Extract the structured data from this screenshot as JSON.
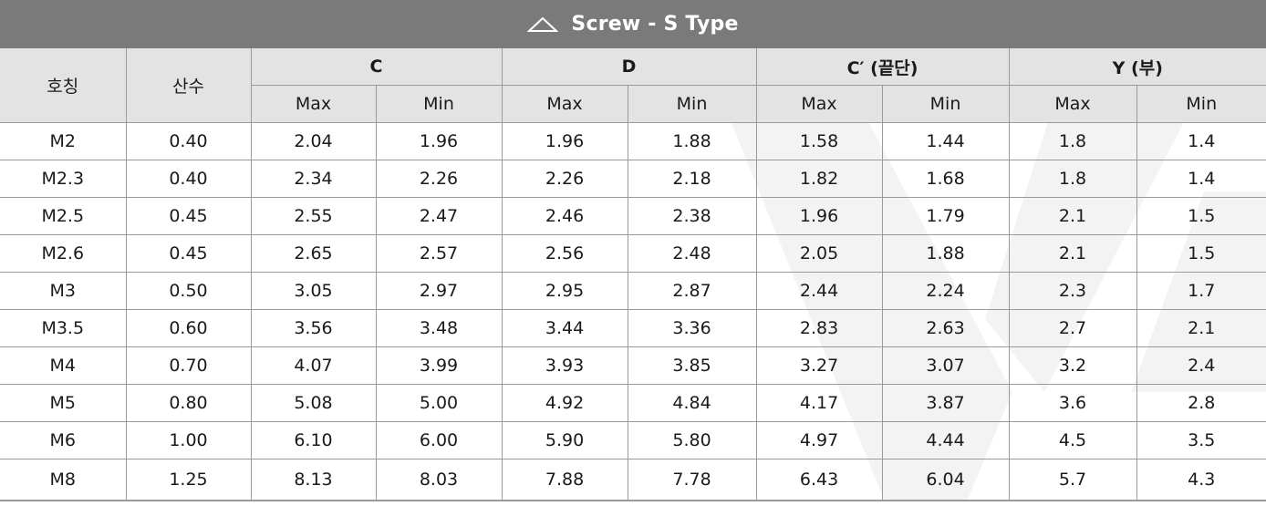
{
  "title": "Screw - S Type",
  "headers": {
    "name": "호칭",
    "pitch": "산수",
    "groups": [
      "C",
      "D",
      "C′ (끝단)",
      "Y (부)"
    ],
    "sub": [
      "Max",
      "Min",
      "Max",
      "Min",
      "Max",
      "Min",
      "Max",
      "Min"
    ]
  },
  "rows": [
    [
      "M2",
      "0.40",
      "2.04",
      "1.96",
      "1.96",
      "1.88",
      "1.58",
      "1.44",
      "1.8",
      "1.4"
    ],
    [
      "M2.3",
      "0.40",
      "2.34",
      "2.26",
      "2.26",
      "2.18",
      "1.82",
      "1.68",
      "1.8",
      "1.4"
    ],
    [
      "M2.5",
      "0.45",
      "2.55",
      "2.47",
      "2.46",
      "2.38",
      "1.96",
      "1.79",
      "2.1",
      "1.5"
    ],
    [
      "M2.6",
      "0.45",
      "2.65",
      "2.57",
      "2.56",
      "2.48",
      "2.05",
      "1.88",
      "2.1",
      "1.5"
    ],
    [
      "M3",
      "0.50",
      "3.05",
      "2.97",
      "2.95",
      "2.87",
      "2.44",
      "2.24",
      "2.3",
      "1.7"
    ],
    [
      "M3.5",
      "0.60",
      "3.56",
      "3.48",
      "3.44",
      "3.36",
      "2.83",
      "2.63",
      "2.7",
      "2.1"
    ],
    [
      "M4",
      "0.70",
      "4.07",
      "3.99",
      "3.93",
      "3.85",
      "3.27",
      "3.07",
      "3.2",
      "2.4"
    ],
    [
      "M5",
      "0.80",
      "5.08",
      "5.00",
      "4.92",
      "4.84",
      "4.17",
      "3.87",
      "3.6",
      "2.8"
    ],
    [
      "M6",
      "1.00",
      "6.10",
      "6.00",
      "5.90",
      "5.80",
      "4.97",
      "4.44",
      "4.5",
      "3.5"
    ],
    [
      "M8",
      "1.25",
      "8.13",
      "8.03",
      "7.88",
      "7.78",
      "6.43",
      "6.04",
      "5.7",
      "4.3"
    ]
  ],
  "colors": {
    "title_bg": "#7a7a7a",
    "header_bg": "#e3e3e3",
    "border": "#9a9a9a"
  },
  "icons": {
    "title": "triangle-outline-icon"
  }
}
